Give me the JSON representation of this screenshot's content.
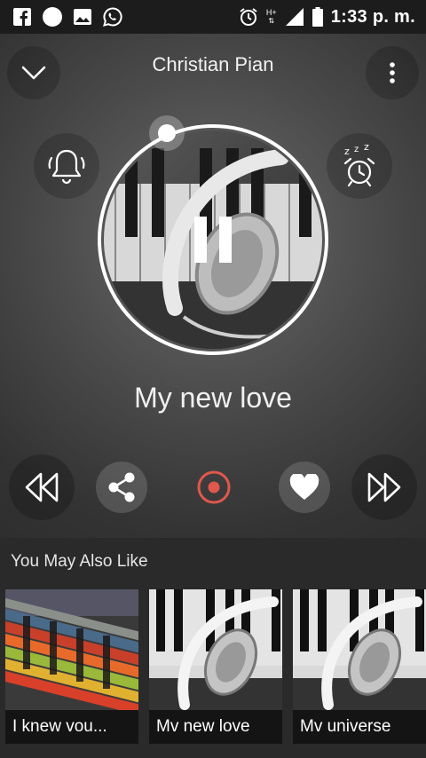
{
  "status_bar": {
    "left_icons": [
      "facebook-icon",
      "circle-notification-icon",
      "image-icon",
      "whatsapp-icon"
    ],
    "right_icons": [
      "alarm-icon",
      "network-hplus-icon",
      "signal-icon",
      "battery-icon"
    ],
    "network_label": "H+",
    "time": "1:33 p. m."
  },
  "header": {
    "station_title": "Christian Pian"
  },
  "player": {
    "song_title": "My new love",
    "state": "playing",
    "progress_fraction": 0.05,
    "colors": {
      "accent_ring": "#ffffff",
      "record_button": "#e0574d"
    }
  },
  "controls": [
    "rewind",
    "share",
    "record",
    "like",
    "fast-forward"
  ],
  "recommendations": {
    "title": "You May Also Like",
    "items": [
      {
        "label": "I knew vou...",
        "art": "colorful-piano-keys"
      },
      {
        "label": "Mv new love",
        "art": "headphones-on-piano"
      },
      {
        "label": "Mv universe",
        "art": "headphones-on-piano"
      }
    ]
  }
}
